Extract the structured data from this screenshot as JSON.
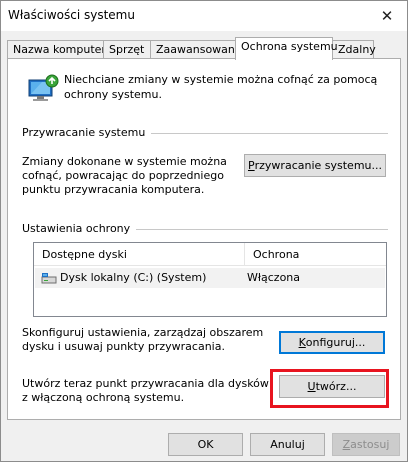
{
  "window": {
    "title": "Właściwości systemu"
  },
  "tabs": [
    {
      "label": "Nazwa komputera"
    },
    {
      "label": "Sprzęt"
    },
    {
      "label": "Zaawansowane"
    },
    {
      "label": "Ochrona systemu"
    },
    {
      "label": "Zdalny"
    }
  ],
  "active_tab": "Ochrona systemu",
  "intro": {
    "text": "Niechciane zmiany w systemie można cofnąć za pomocą ochrony systemu."
  },
  "restore": {
    "group_title": "Przywracanie systemu",
    "description": "Zmiany dokonane w systemie można cofnąć, powracając do poprzedniego punktu przywracania komputera.",
    "button_accel": "P",
    "button_rest": "rzywracanie systemu..."
  },
  "protection": {
    "group_title": "Ustawienia ochrony",
    "columns": [
      "Dostępne dyski",
      "Ochrona"
    ],
    "rows": [
      {
        "drive": "Dysk lokalny (C:) (System)",
        "status": "Włączona"
      }
    ],
    "configure_text": "Skonfiguruj ustawienia, zarządzaj obszarem dysku i usuwaj punkty przywracania.",
    "configure_accel": "K",
    "configure_rest": "onfiguruj...",
    "create_text": "Utwórz teraz punkt przywracania dla dysków z włączoną ochroną systemu.",
    "create_accel": "U",
    "create_rest": "twórz..."
  },
  "footer": {
    "ok": "OK",
    "cancel": "Anuluj",
    "apply_accel": "Z",
    "apply_rest": "astosuj"
  },
  "colors": {
    "accent": "#0078d7",
    "highlight_box": "#e8141f"
  }
}
